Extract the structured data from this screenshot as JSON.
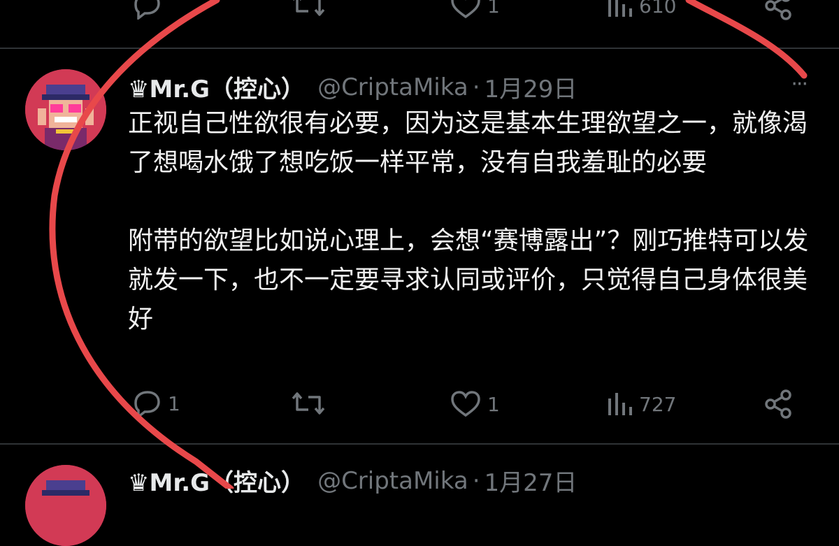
{
  "tweet_prev": {
    "metrics": {
      "replies": "",
      "retweets": "",
      "likes": "1",
      "views": "610"
    }
  },
  "tweet_main": {
    "display_name": "♛Mr.G（控心）",
    "handle": "@CriptaMika",
    "separator": "·",
    "date": "1月29日",
    "paragraphs": [
      "正视自己性欲很有必要，因为这是基本生理欲望之一，就像渴了想喝水饿了想吃饭一样平常，没有自我羞耻的必要",
      "附带的欲望比如说心理上，会想“赛博露出”？刚巧推特可以发就发一下，也不一定要寻求认同或评价，只觉得自己身体很美好"
    ],
    "metrics": {
      "replies": "1",
      "retweets": "",
      "likes": "1",
      "views": "727"
    }
  },
  "tweet_next": {
    "display_name": "♛Mr.G（控心）",
    "handle": "@CriptaMika",
    "separator": "·",
    "date": "1月27日"
  },
  "colors": {
    "background": "#000000",
    "text": "#e7e9ea",
    "muted": "#71767b",
    "annotation": "#e8484a"
  },
  "icons": [
    "reply-icon",
    "retweet-icon",
    "like-icon",
    "views-icon",
    "share-icon",
    "more-icon"
  ]
}
